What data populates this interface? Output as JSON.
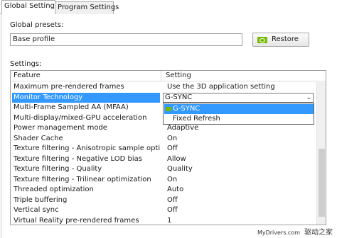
{
  "tabs": [
    {
      "label": "Global Settings",
      "active": true
    },
    {
      "label": "Program Settings",
      "active": false
    }
  ],
  "global_presets": {
    "label": "Global presets:",
    "value": "Base profile",
    "restore_label": "Restore"
  },
  "settings": {
    "label": "Settings:",
    "columns": {
      "feature": "Feature",
      "setting": "Setting"
    },
    "rows": [
      {
        "feature": "Maximum pre-rendered frames",
        "setting": "Use the 3D application setting"
      },
      {
        "feature": "Monitor Technology",
        "setting": ""
      },
      {
        "feature": "Multi-Frame Sampled AA (MFAA)",
        "setting": ""
      },
      {
        "feature": "Multi-display/mixed-GPU acceleration",
        "setting": ""
      },
      {
        "feature": "Power management mode",
        "setting": "Adaptive"
      },
      {
        "feature": "Shader Cache",
        "setting": "On"
      },
      {
        "feature": "Texture filtering - Anisotropic sample opti...",
        "setting": "Off"
      },
      {
        "feature": "Texture filtering - Negative LOD bias",
        "setting": "Allow"
      },
      {
        "feature": "Texture filtering - Quality",
        "setting": "Quality"
      },
      {
        "feature": "Texture filtering - Trilinear optimization",
        "setting": "On"
      },
      {
        "feature": "Threaded optimization",
        "setting": "Auto"
      },
      {
        "feature": "Triple buffering",
        "setting": "Off"
      },
      {
        "feature": "Vertical sync",
        "setting": "Off"
      },
      {
        "feature": "Virtual Reality pre-rendered frames",
        "setting": "1"
      }
    ],
    "selected_index": 1,
    "monitor_combo": {
      "value": "G-SYNC",
      "options": [
        "G-SYNC",
        "Fixed Refresh"
      ],
      "highlighted": "G-SYNC"
    }
  },
  "icons": {
    "restore": "nvidia-logo-icon",
    "dropdown": "chevron-down-icon",
    "option": "nvidia-logo-icon"
  },
  "colors": {
    "selection": "#3399ff",
    "nvidia_green": "#76b900"
  },
  "watermark": {
    "text": "MyDrivers.com",
    "cn_text": "驱动之家"
  }
}
